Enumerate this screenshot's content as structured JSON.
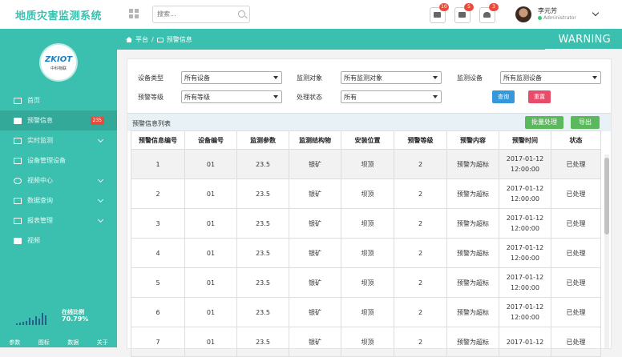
{
  "app": {
    "title": "地质灾害监测系统"
  },
  "search": {
    "placeholder": "搜索..."
  },
  "notifications": [
    {
      "icon": "inbox-icon",
      "count": "10"
    },
    {
      "icon": "mail-icon",
      "count": "5"
    },
    {
      "icon": "bell-icon",
      "count": "3"
    }
  ],
  "user": {
    "name": "李元芳",
    "role": "Administrator"
  },
  "sidebar": {
    "logo_text": "ZKIOT",
    "logo_sub": "中科物联",
    "items": [
      {
        "label": "首页",
        "icon": "monitor-icon",
        "active": false
      },
      {
        "label": "预警信息",
        "icon": "envelope-icon",
        "active": true,
        "badge": "235"
      },
      {
        "label": "实时监测",
        "icon": "copy-icon",
        "active": false,
        "expand": true
      },
      {
        "label": "设备管理设备",
        "icon": "server-icon",
        "active": false
      },
      {
        "label": "视频中心",
        "icon": "settings-icon",
        "active": false,
        "expand": true
      },
      {
        "label": "数据查询",
        "icon": "list-icon",
        "active": false,
        "expand": true
      },
      {
        "label": "报表管理",
        "icon": "table-icon",
        "active": false,
        "expand": true
      },
      {
        "label": "视频",
        "icon": "video-icon",
        "active": false
      }
    ],
    "online": {
      "label": "在线比例",
      "value": "70.79%"
    },
    "footer": [
      "参数",
      "图标",
      "数据",
      "关于"
    ]
  },
  "breadcrumb": {
    "home": "平台",
    "separator": "/",
    "current": "预警信息"
  },
  "page_banner": "WARNING",
  "filters": {
    "device_type": {
      "label": "设备类型",
      "value": "所有设备"
    },
    "monitor_target": {
      "label": "监测对象",
      "value": "所有监测对象"
    },
    "monitor_device": {
      "label": "监测设备",
      "value": "所有监测设备"
    },
    "warn_level": {
      "label": "预警等级",
      "value": "所有等级"
    },
    "status": {
      "label": "处理状态",
      "value": "所有"
    },
    "query_label": "查询",
    "reset_label": "重置"
  },
  "list": {
    "title": "预警信息列表",
    "batch_label": "批量处理",
    "export_label": "导出",
    "columns": [
      "预警信息编号",
      "设备编号",
      "监测参数",
      "监测结构物",
      "安装位置",
      "预警等级",
      "预警内容",
      "预警时间",
      "状态"
    ],
    "rows": [
      [
        "1",
        "01",
        "23.5",
        "银矿",
        "坝顶",
        "2",
        "预警为超标",
        "2017-01-12 12:00:00",
        "已处理"
      ],
      [
        "2",
        "01",
        "23.5",
        "银矿",
        "坝顶",
        "2",
        "预警为超标",
        "2017-01-12 12:00:00",
        "已处理"
      ],
      [
        "3",
        "01",
        "23.5",
        "银矿",
        "坝顶",
        "2",
        "预警为超标",
        "2017-01-12 12:00:00",
        "已处理"
      ],
      [
        "4",
        "01",
        "23.5",
        "银矿",
        "坝顶",
        "2",
        "预警为超标",
        "2017-01-12 12:00:00",
        "已处理"
      ],
      [
        "5",
        "01",
        "23.5",
        "银矿",
        "坝顶",
        "2",
        "预警为超标",
        "2017-01-12 12:00:00",
        "已处理"
      ],
      [
        "6",
        "01",
        "23.5",
        "银矿",
        "坝顶",
        "2",
        "预警为超标",
        "2017-01-12 12:00:00",
        "已处理"
      ],
      [
        "7",
        "01",
        "23.5",
        "银矿",
        "坝顶",
        "2",
        "预警为超标",
        "2017-01-12",
        "已处理"
      ]
    ]
  },
  "colors": {
    "accent": "#3bbfae",
    "badge": "#e74c3c",
    "query": "#3498db",
    "reset": "#e84c6b",
    "green": "#5cb85c"
  }
}
